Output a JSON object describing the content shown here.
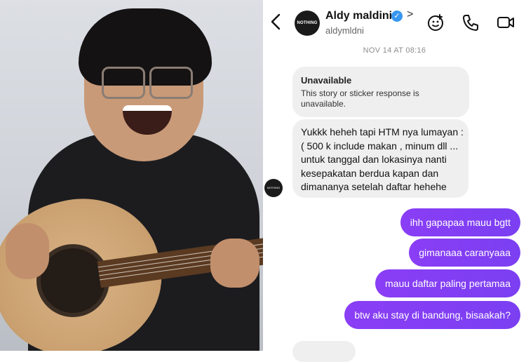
{
  "chat": {
    "header": {
      "avatar_text": "NOTHING EST",
      "name": "Aldy maldini",
      "handle": "aldymldni",
      "verified_icon": "verified-check-icon",
      "icons": [
        "back-arrow-icon",
        "chevron-right-icon",
        "sticker-icon",
        "phone-icon",
        "video-icon"
      ]
    },
    "timestamp": "NOV 14 AT 08:16",
    "incoming": {
      "unavailable_title": "Unavailable",
      "unavailable_body": "This story or sticker response is unavailable.",
      "message": "Yukkk heheh tapi HTM nya lumayan : ( 500 k include makan , minum dll ... untuk tanggal dan lokasinya nanti kesepakatan berdua kapan dan dimananya setelah daftar hehehe"
    },
    "outgoing": [
      "ihh gapapaa mauu bgtt",
      "gimanaaa caranyaaa",
      "mauu daftar paling pertamaa",
      "btw aku stay di bandung, bisaakah?"
    ],
    "colors": {
      "outgoing_bubble": "#7f3ff0",
      "incoming_bubble": "#efefef",
      "verified": "#3897f0"
    }
  }
}
